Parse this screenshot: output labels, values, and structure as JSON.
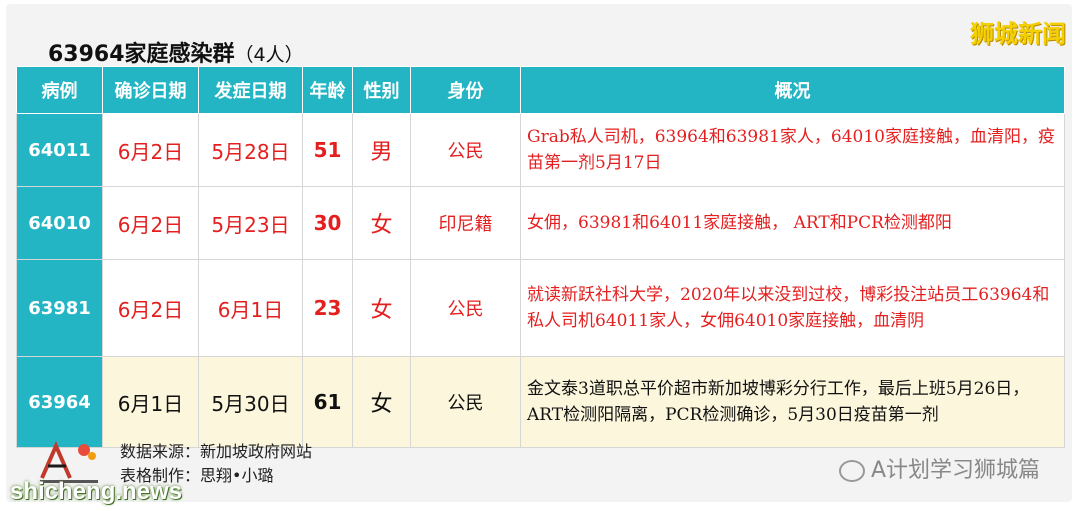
{
  "title": "63964家庭感染群",
  "title_count": "（4人）",
  "brand": "狮城新闻",
  "headers": [
    "病例",
    "确诊日期",
    "发症日期",
    "年龄",
    "性别",
    "身份",
    "概况"
  ],
  "rows": [
    {
      "id": "64011",
      "confirm": "6月2日",
      "onset": "5月28日",
      "age": "51",
      "gender": "男",
      "identity": "公民",
      "desc": "Grab私人司机，63964和63981家人，64010家庭接触，血清阳，疫苗第一剂5月17日"
    },
    {
      "id": "64010",
      "confirm": "6月2日",
      "onset": "5月23日",
      "age": "30",
      "gender": "女",
      "identity": "印尼籍",
      "desc": "女佣，63981和64011家庭接触， ART和PCR检测都阳"
    },
    {
      "id": "63981",
      "confirm": "6月2日",
      "onset": "6月1日",
      "age": "23",
      "gender": "女",
      "identity": "公民",
      "desc": "就读新跃社科大学，2020年以来没到过校，博彩投注站员工63964和私人司机64011家人，女佣64010家庭接触，血清阴"
    },
    {
      "id": "63964",
      "confirm": "6月1日",
      "onset": "5月30日",
      "age": "61",
      "gender": "女",
      "identity": "公民",
      "desc": "金文泰3道职总平价超市新加坡博彩分行工作，最后上班5月26日，ART检测阳隔离，PCR检测确诊，5月30日疫苗第一剂"
    }
  ],
  "footer": {
    "source": "数据来源：新加坡政府网站",
    "maker": "表格制作：思翔•小璐",
    "wechat": "A计划学习狮城篇",
    "site": "shicheng.news"
  },
  "colors": {
    "header": "#23b5c3",
    "accent_text": "#e41f1f",
    "last_row_bg": "#fbf6dc"
  }
}
